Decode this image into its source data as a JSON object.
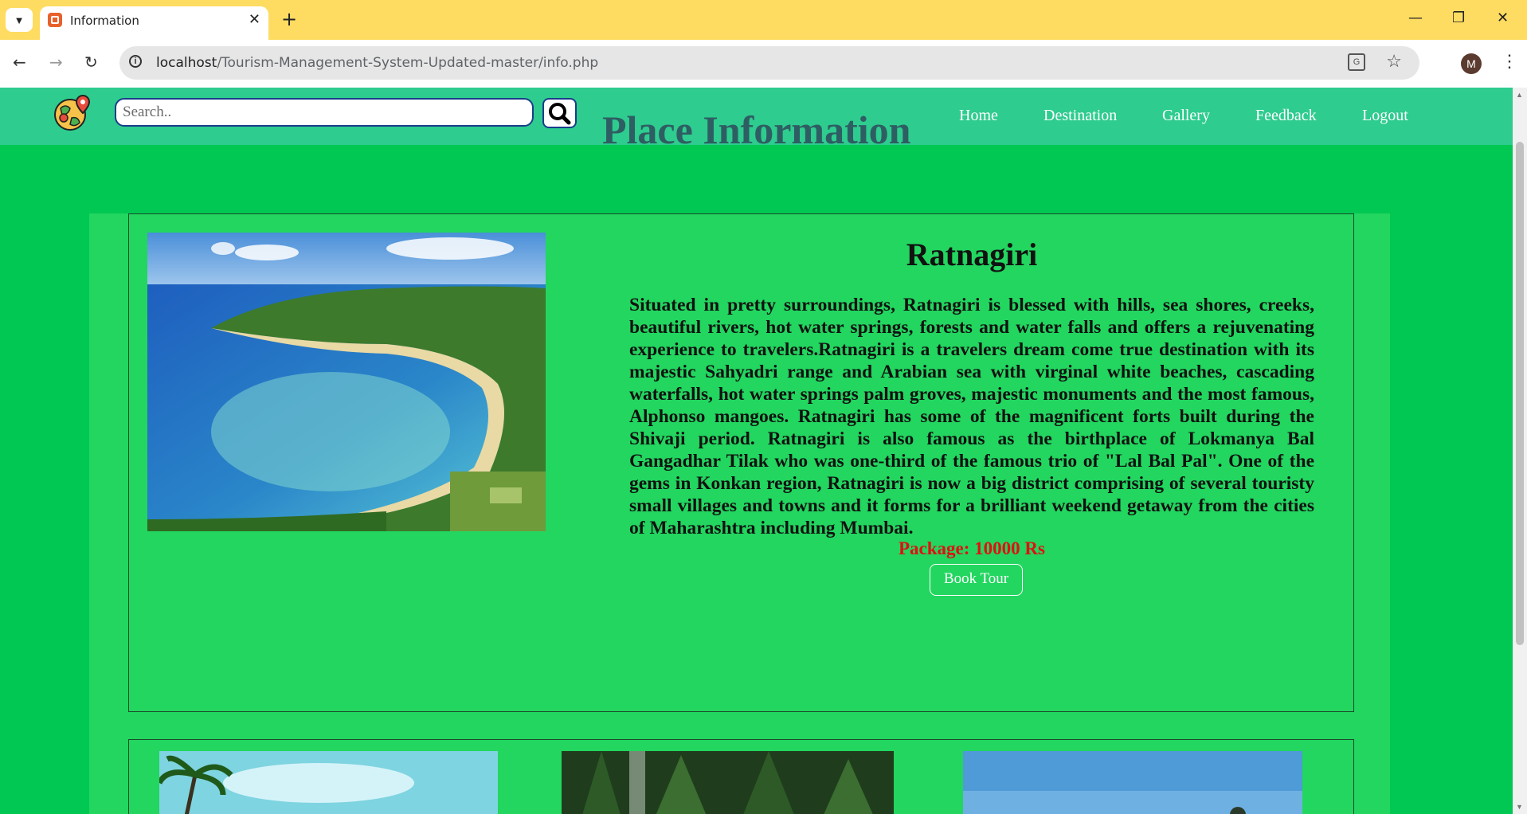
{
  "browser": {
    "tab_title": "Information",
    "tab_close": "✕",
    "new_tab": "+",
    "url_host": "localhost",
    "url_path": "/Tourism-Management-System-Updated-master/info.php",
    "profile_initial": "M",
    "window_controls": [
      "—",
      "❐",
      "✕"
    ]
  },
  "header": {
    "search_placeholder": "Search..",
    "page_title": "Place Information",
    "nav": [
      "Home",
      "Destination",
      "Gallery",
      "Feedback",
      "Logout"
    ]
  },
  "place": {
    "name": "Ratnagiri",
    "description": "Situated in pretty surroundings, Ratnagiri is blessed with hills, sea shores, creeks, beautiful rivers, hot water springs, forests and water falls and offers a rejuvenating experience to travelers.Ratnagiri is a travelers dream come true destination with its majestic Sahyadri range and Arabian sea with virginal white beaches, cascading waterfalls, hot water springs palm groves, majestic monuments and the most famous, Alphonso mangoes. Ratnagiri has some of the magnificent forts built during the Shivaji period. Ratnagiri is also famous as the birthplace of Lokmanya Bal Gangadhar Tilak who was one-third of the famous trio of \"Lal Bal Pal\". One of the gems in Konkan region, Ratnagiri is now a big district comprising of several touristy small villages and towns and it forms for a brilliant weekend getaway from the cities of Maharashtra including Mumbai.",
    "package": "Package: 10000 Rs",
    "book_label": "Book Tour"
  },
  "colors": {
    "page_bg": "#01c853",
    "header_bg": "#2ecc8f",
    "card_bg": "#22d65f",
    "title": "#2e5e63",
    "package": "#e01010",
    "browser_frame": "#fedc61"
  }
}
